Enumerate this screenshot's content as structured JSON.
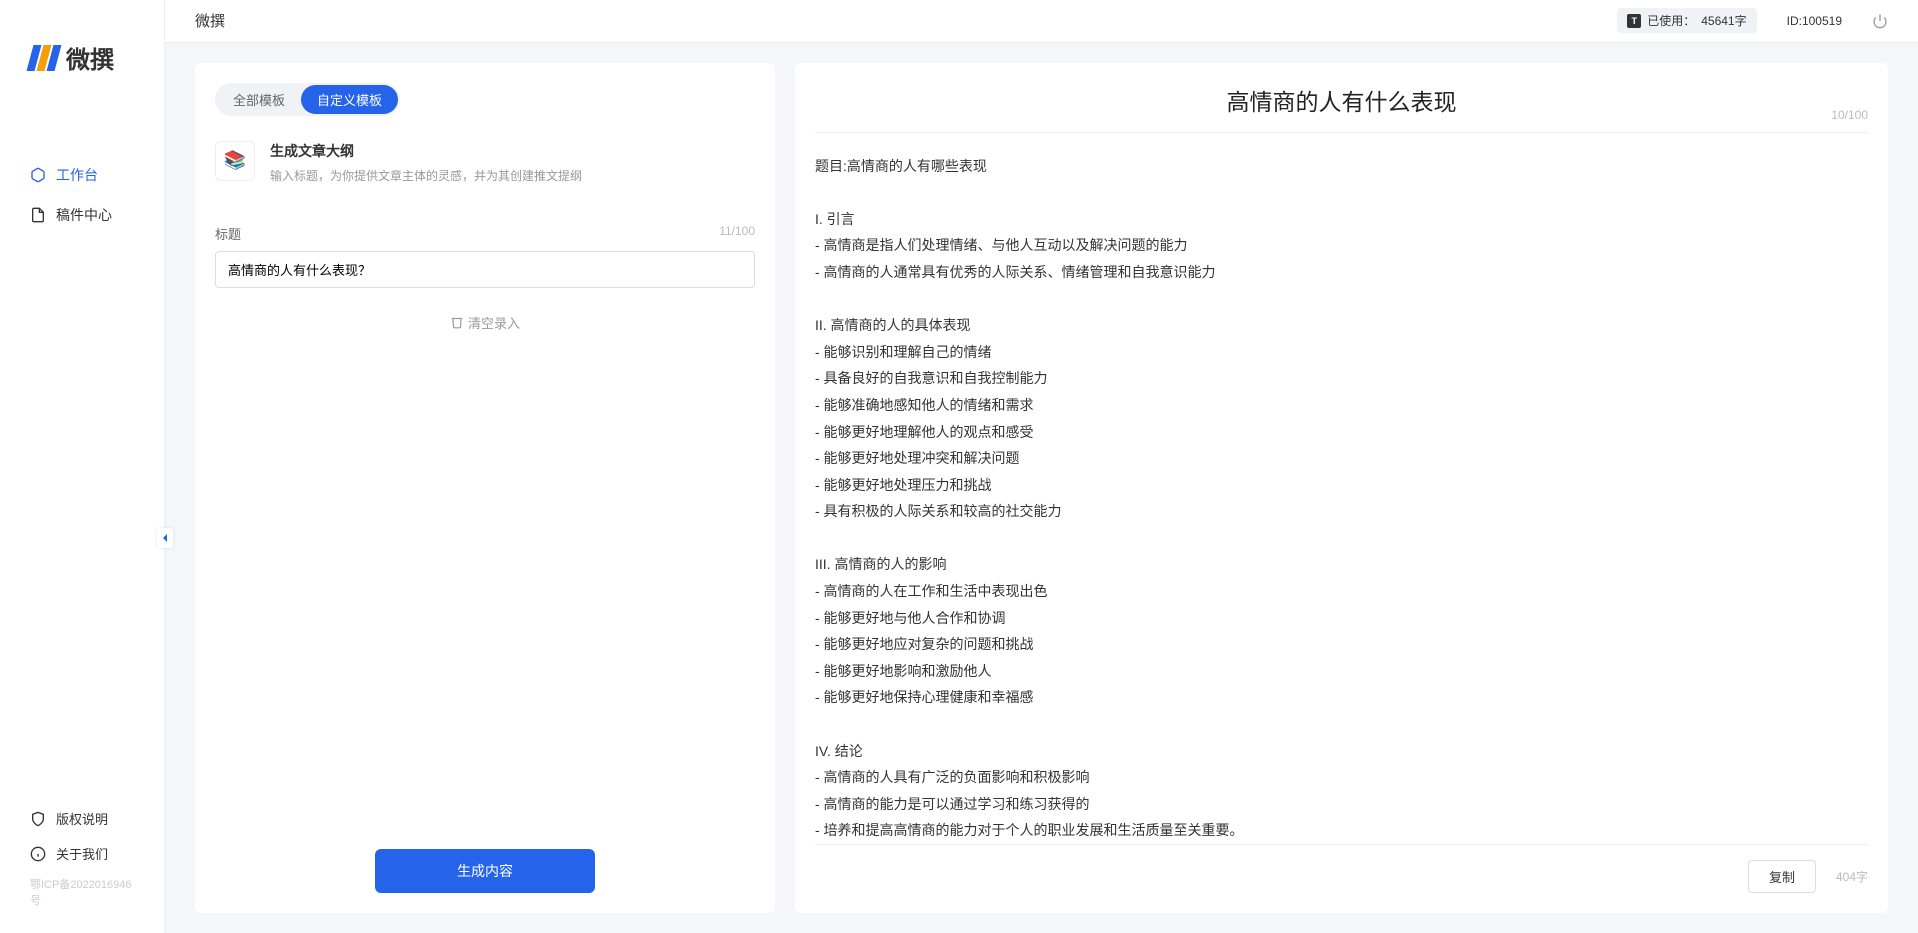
{
  "app_name": "微撰",
  "topbar": {
    "title": "微撰",
    "usage_label": "已使用：",
    "usage_value": "45641字",
    "user_id_label": "ID:",
    "user_id": "100519"
  },
  "sidebar": {
    "nav": [
      {
        "label": "工作台",
        "icon": "cube",
        "active": true
      },
      {
        "label": "稿件中心",
        "icon": "document",
        "active": false
      }
    ],
    "bottom": [
      {
        "label": "版权说明",
        "icon": "shield"
      },
      {
        "label": "关于我们",
        "icon": "info"
      }
    ],
    "icp": "鄂ICP备2022016946号"
  },
  "left_panel": {
    "tabs": [
      {
        "label": "全部模板",
        "active": false
      },
      {
        "label": "自定义模板",
        "active": true
      }
    ],
    "template": {
      "name": "生成文章大纲",
      "desc": "输入标题，为你提供文章主体的灵感，并为其创建推文提纲"
    },
    "field_label": "标题",
    "title_counter": "11/100",
    "title_value": "高情商的人有什么表现？",
    "clear_label": "清空录入",
    "generate_label": "生成内容"
  },
  "output": {
    "title": "高情商的人有什么表现",
    "title_counter": "10/100",
    "body": "题目:高情商的人有哪些表现\n\nI. 引言\n- 高情商是指人们处理情绪、与他人互动以及解决问题的能力\n- 高情商的人通常具有优秀的人际关系、情绪管理和自我意识能力\n\nII. 高情商的人的具体表现\n- 能够识别和理解自己的情绪\n- 具备良好的自我意识和自我控制能力\n- 能够准确地感知他人的情绪和需求\n- 能够更好地理解他人的观点和感受\n- 能够更好地处理冲突和解决问题\n- 能够更好地处理压力和挑战\n- 具有积极的人际关系和较高的社交能力\n\nIII. 高情商的人的影响\n- 高情商的人在工作和生活中表现出色\n- 能够更好地与他人合作和协调\n- 能够更好地应对复杂的问题和挑战\n- 能够更好地影响和激励他人\n- 能够更好地保持心理健康和幸福感\n\nIV. 结论\n- 高情商的人具有广泛的负面影响和积极影响\n- 高情商的能力是可以通过学习和练习获得的\n- 培养和提高高情商的能力对于个人的职业发展和生活质量至关重要。",
    "copy_label": "复制",
    "char_count": "404字"
  }
}
